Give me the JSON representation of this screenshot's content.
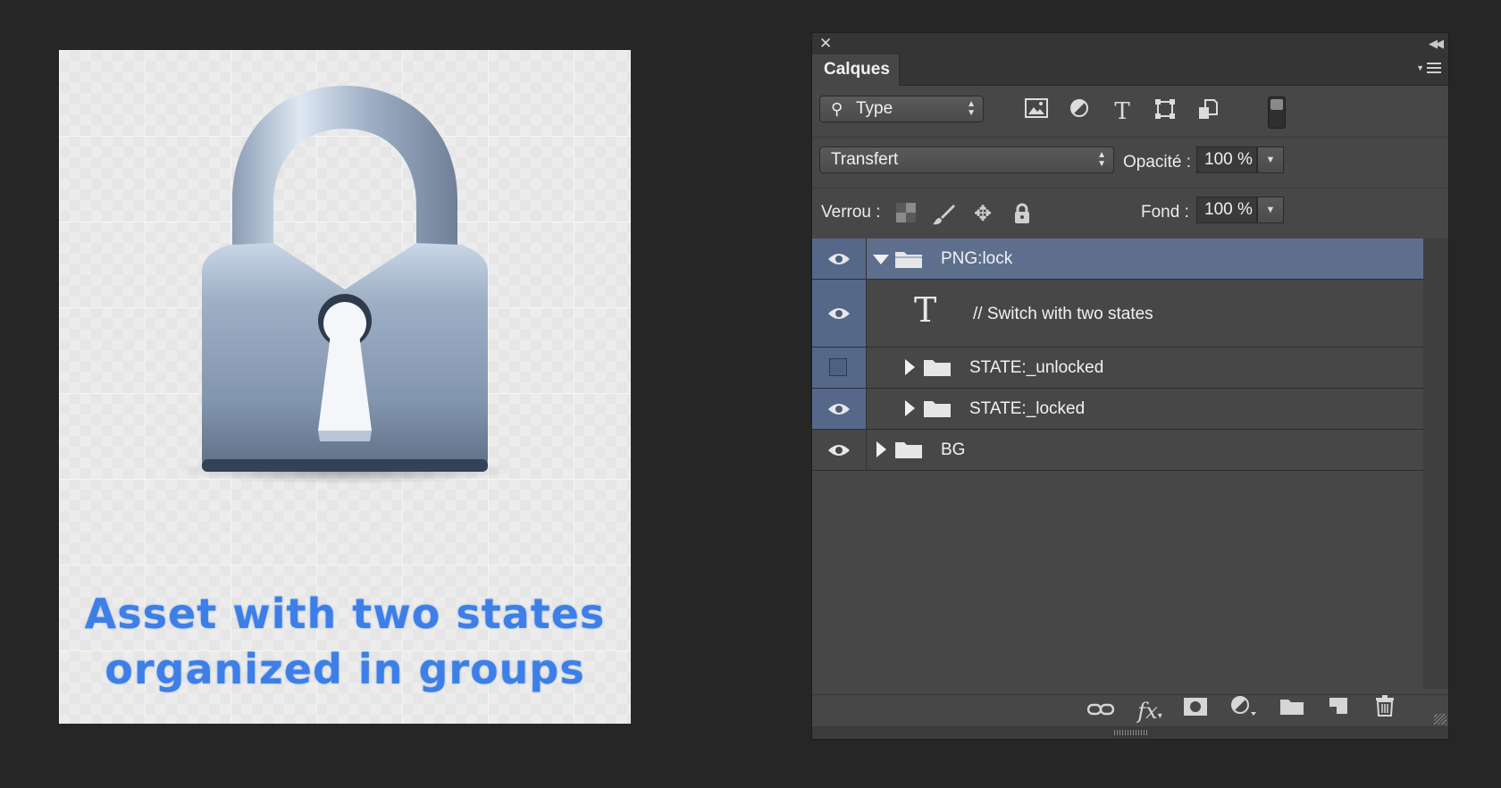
{
  "preview": {
    "caption_line1": "Asset with two states",
    "caption_line2": "organized in groups"
  },
  "panel": {
    "tab_label": "Calques",
    "filter": {
      "label": "Type"
    },
    "filter_icons": [
      "image-filter-icon",
      "adjustment-filter-icon",
      "type-filter-icon",
      "shape-filter-icon",
      "smart-object-filter-icon"
    ],
    "blend_mode": "Transfert",
    "opacity_label": "Opacité :",
    "opacity_value": "100 %",
    "lock_label": "Verrou :",
    "fill_label": "Fond :",
    "fill_value": "100 %",
    "layers": [
      {
        "name": "PNG:lock",
        "type": "group",
        "expanded": true,
        "visible": true,
        "selected": true
      },
      {
        "name": "// Switch with two states",
        "type": "text",
        "visible": true
      },
      {
        "name": "STATE:_unlocked",
        "type": "group",
        "expanded": false,
        "visible": false
      },
      {
        "name": "STATE:_locked",
        "type": "group",
        "expanded": false,
        "visible": true
      },
      {
        "name": "BG",
        "type": "group",
        "expanded": false,
        "visible": true
      }
    ],
    "bottom_icons": [
      "link-icon",
      "fx-icon",
      "mask-icon",
      "adjustment-icon",
      "new-group-icon",
      "new-layer-icon",
      "trash-icon"
    ],
    "colors": {
      "selection": "#5d6f8d",
      "panel_bg": "#474747",
      "caption": "#3d7fe6"
    }
  }
}
